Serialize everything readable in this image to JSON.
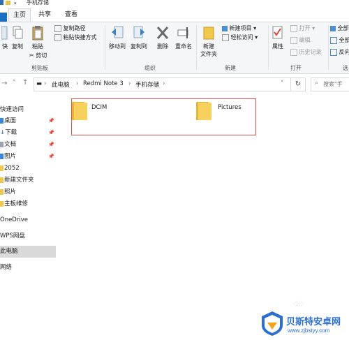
{
  "window": {
    "title": "手机存储"
  },
  "ribbon_tabs": [
    {
      "label": "主页"
    },
    {
      "label": "共享"
    },
    {
      "label": "查看"
    }
  ],
  "ribbon": {
    "clipboard": {
      "group_label": "剪贴板",
      "pin_label": "快",
      "copy_label": "复制",
      "paste_label": "粘贴",
      "copy_path": "复制路径",
      "paste_shortcut": "粘贴快捷方式",
      "cut": "剪切"
    },
    "organize": {
      "group_label": "组织",
      "move_to": "移动到",
      "copy_to": "复制到",
      "delete": "删除",
      "rename": "重命名"
    },
    "new": {
      "group_label": "新建",
      "new_folder_line1": "新建",
      "new_folder_line2": "文件夹",
      "new_item": "新建项目 ▾",
      "easy_access": "轻松访问 ▾"
    },
    "open": {
      "group_label": "打开",
      "properties": "属性",
      "open": "打开 ▾",
      "edit": "编辑",
      "history": "历史记录"
    },
    "select": {
      "group_label": "选",
      "select_all": "全部",
      "select_none": "全部",
      "invert": "反向"
    }
  },
  "address": {
    "crumbs": [
      "此电脑",
      "Redmi Note 3",
      "手机存储"
    ],
    "search_placeholder": "搜索\"手"
  },
  "nav": {
    "quick_access": "快速访问",
    "items": [
      {
        "label": "桌面",
        "pinned": true
      },
      {
        "label": "下载",
        "pinned": true
      },
      {
        "label": "文档",
        "pinned": true
      },
      {
        "label": "图片",
        "pinned": true
      },
      {
        "label": "2052",
        "pinned": false
      },
      {
        "label": "新建文件夹",
        "pinned": false
      },
      {
        "label": "照片",
        "pinned": false
      },
      {
        "label": "主板维修",
        "pinned": false
      }
    ],
    "onedrive": "OneDrive",
    "wps": "WPS网盘",
    "this_pc": "此电脑",
    "network": "网络"
  },
  "content": {
    "folders": [
      {
        "name": "DCIM"
      },
      {
        "name": "Pictures"
      }
    ]
  },
  "watermark": {
    "title": "贝斯特安卓网",
    "url": "www.zjbstyy.com"
  },
  "colors": {
    "accent": "#1a6fc2",
    "folder": "#f7d15c",
    "selection_border": "#d9534f",
    "nav_selected": "#d9d9d9"
  }
}
